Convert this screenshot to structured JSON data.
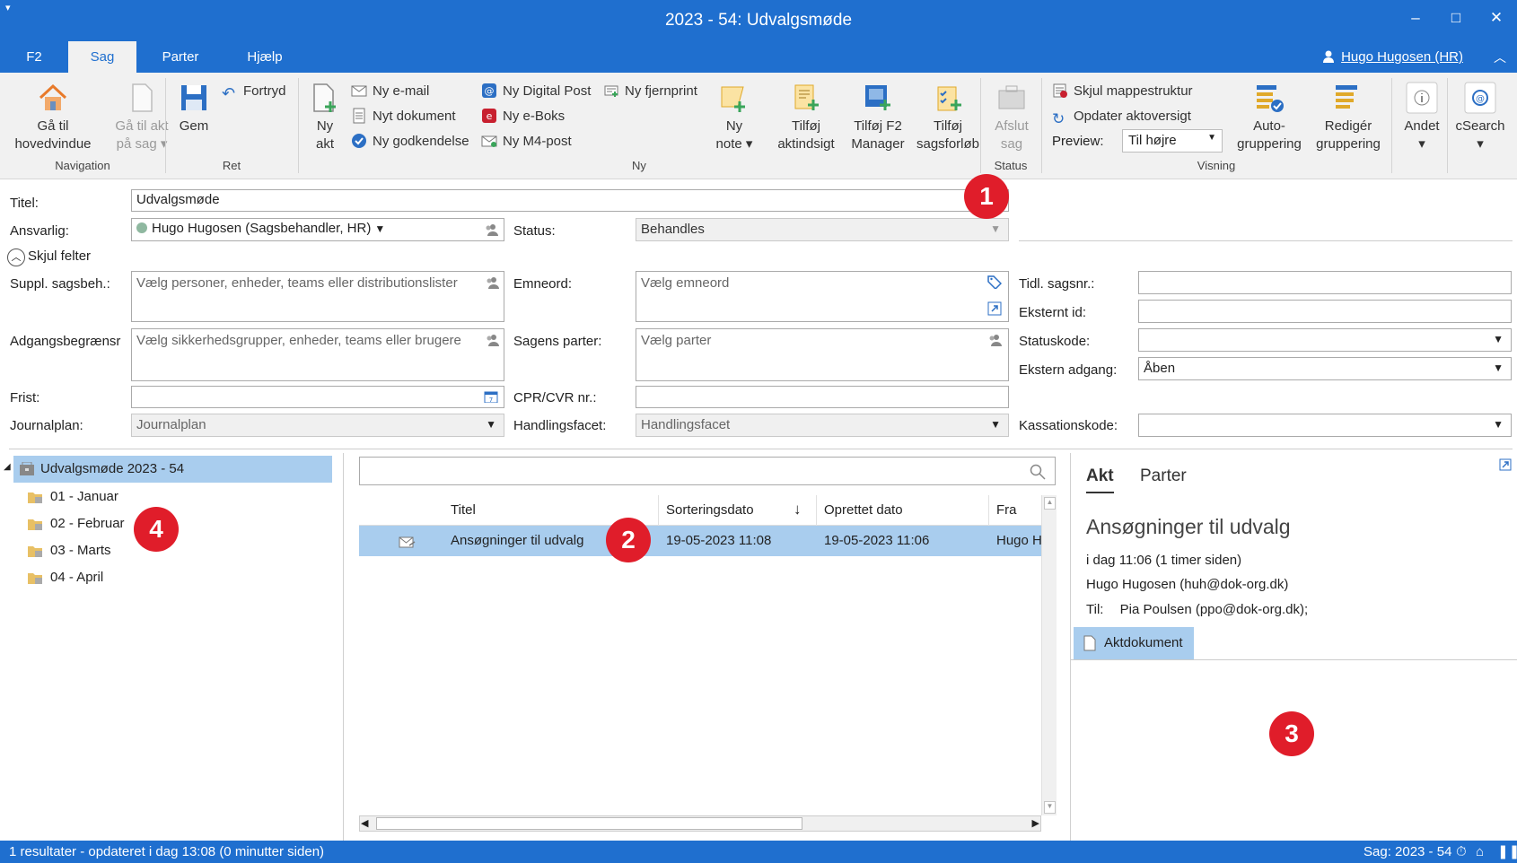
{
  "window": {
    "title": "2023 - 54: Udvalgsmøde",
    "quick_access": "▾",
    "minimize": "–",
    "maximize": "□",
    "close": "✕"
  },
  "tabs": [
    "F2",
    "Sag",
    "Parter",
    "Hjælp"
  ],
  "user": {
    "label": "Hugo Hugosen (HR)"
  },
  "ribbon": {
    "navigation": {
      "label": "Navigation",
      "goto_main_1": "Gå til",
      "goto_main_2": "hovedvindue",
      "goto_akt_1": "Gå til akt",
      "goto_akt_2": "på sag ▾"
    },
    "ret": {
      "label": "Ret",
      "save": "Gem",
      "undo": "Fortryd"
    },
    "ny": {
      "label": "Ny",
      "ny_akt_1": "Ny",
      "ny_akt_2": "akt",
      "ny_email": "Ny e-mail",
      "nyt_dokument": "Nyt dokument",
      "ny_godkendelse": "Ny godkendelse",
      "ny_digital_post": "Ny Digital Post",
      "ny_eboks": "Ny e-Boks",
      "ny_m4": "Ny M4-post",
      "ny_fjernprint": "Ny fjernprint",
      "ny_note_1": "Ny",
      "ny_note_2": "note ▾",
      "tilfoj_aktindsigt_1": "Tilføj",
      "tilfoj_aktindsigt_2": "aktindsigt",
      "tilfoj_f2_1": "Tilføj F2",
      "tilfoj_f2_2": "Manager",
      "tilfoj_sags_1": "Tilføj",
      "tilfoj_sags_2": "sagsforløb"
    },
    "status": {
      "label": "Status",
      "afslut_1": "Afslut",
      "afslut_2": "sag"
    },
    "visning": {
      "label": "Visning",
      "skjul": "Skjul mappestruktur",
      "opdater": "Opdater aktoversigt",
      "preview_label": "Preview:",
      "preview_value": "Til højre",
      "auto_1": "Auto-",
      "auto_2": "gruppering",
      "rediger_1": "Redigér",
      "rediger_2": "gruppering"
    },
    "andet": "Andet",
    "csearch": "cSearch"
  },
  "form": {
    "titel_label": "Titel:",
    "titel_value": "Udvalgsmøde",
    "ansvarlig_label": "Ansvarlig:",
    "ansvarlig_value": "Hugo Hugosen (Sagsbehandler, HR)",
    "status_label": "Status:",
    "status_value": "Behandles",
    "skjul_felter": "Skjul felter",
    "suppl_label": "Suppl. sagsbeh.:",
    "suppl_placeholder": "Vælg personer, enheder, teams eller distributionslister",
    "emneord_label": "Emneord:",
    "emneord_placeholder": "Vælg emneord",
    "tidl_label": "Tidl. sagsnr.:",
    "eksternt_label": "Eksternt id:",
    "adgang_label": "Adgangsbegrænsr",
    "adgang_placeholder": "Vælg sikkerhedsgrupper, enheder, teams eller brugere",
    "parter_label": "Sagens parter:",
    "parter_placeholder": "Vælg parter",
    "statuskode_label": "Statuskode:",
    "ekstern_adgang_label": "Ekstern adgang:",
    "ekstern_adgang_value": "Åben",
    "frist_label": "Frist:",
    "cpr_label": "CPR/CVR nr.:",
    "journalplan_label": "Journalplan:",
    "journalplan_placeholder": "Journalplan",
    "handlingsfacet_label": "Handlingsfacet:",
    "handlingsfacet_placeholder": "Handlingsfacet",
    "kassationskode_label": "Kassationskode:"
  },
  "tree": {
    "root": "Udvalgsmøde 2023 - 54",
    "items": [
      "01 - Januar",
      "02 - Februar",
      "03 - Marts",
      "04 - April"
    ]
  },
  "grid": {
    "columns": [
      "Titel",
      "Sorteringsdato",
      "Oprettet dato",
      "Fra"
    ],
    "sort_arrow": "↓",
    "rows": [
      {
        "titel": "Ansøgninger til udvalg",
        "sorteringsdato": "19-05-2023 11:08",
        "oprettet": "19-05-2023 11:06",
        "fra": "Hugo H"
      }
    ]
  },
  "detail": {
    "tabs": [
      "Akt",
      "Parter"
    ],
    "title": "Ansøgninger til udvalg",
    "time": "i dag 11:06 (1 timer siden)",
    "from": "Hugo Hugosen (huh@dok-org.dk)",
    "to_label": "Til:",
    "to_value": "Pia Poulsen (ppo@dok-org.dk);",
    "document": "Aktdokument"
  },
  "statusbar": {
    "left": "1 resultater - opdateret i dag 13:08 (0 minutter siden)",
    "right": "Sag: 2023 - 54"
  },
  "badges": [
    "1",
    "2",
    "3",
    "4"
  ],
  "colors": {
    "accent": "#1f6fcf",
    "selection": "#a9cdee",
    "badge": "#e01d2a"
  }
}
